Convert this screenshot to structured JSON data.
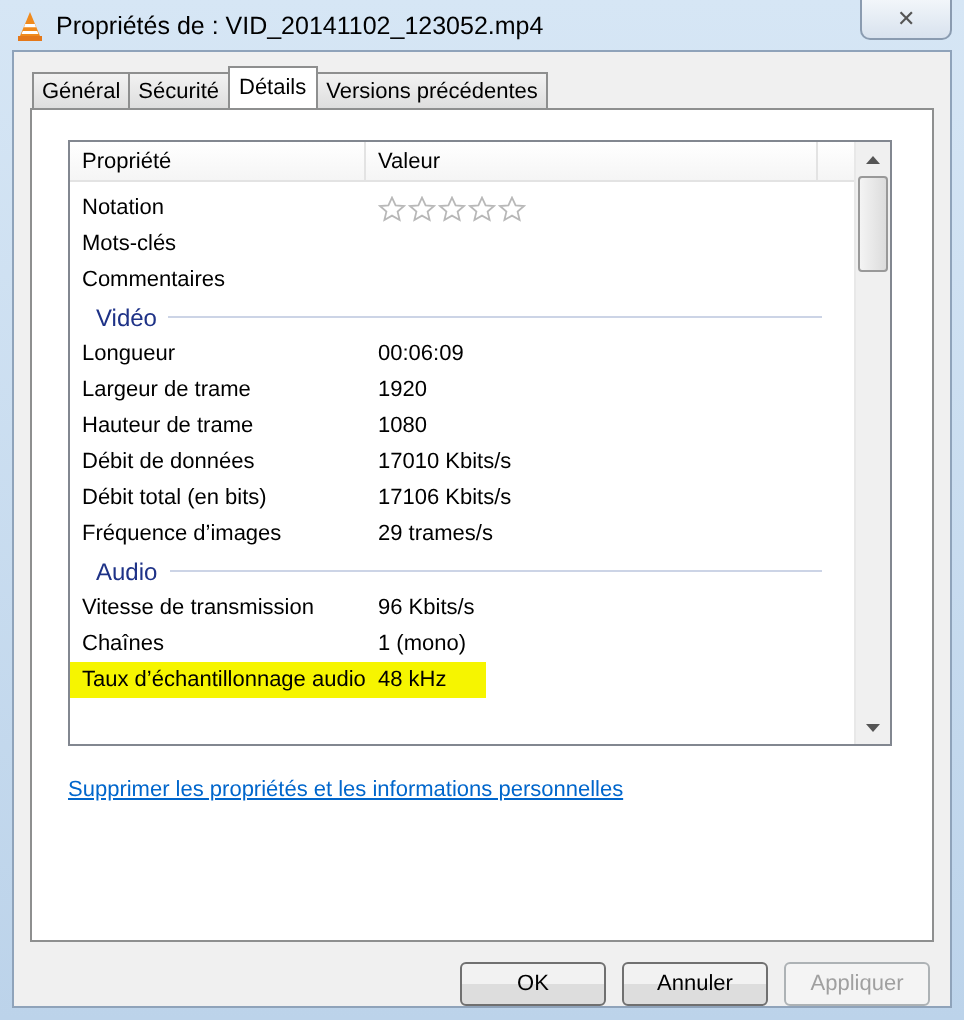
{
  "window": {
    "title": "Propriétés de : VID_20141102_123052.mp4",
    "close": "✕"
  },
  "tabs": [
    {
      "label": "Général",
      "selected": false
    },
    {
      "label": "Sécurité",
      "selected": false
    },
    {
      "label": "Détails",
      "selected": true
    },
    {
      "label": "Versions précédentes",
      "selected": false
    }
  ],
  "table": {
    "columns": [
      "Propriété",
      "Valeur"
    ],
    "rows": [
      {
        "kind": "stars",
        "name": "Notation",
        "stars": 0
      },
      {
        "kind": "property",
        "name": "Mots-clés",
        "value": "",
        "highlighted": false
      },
      {
        "kind": "property",
        "name": "Commentaires",
        "value": "",
        "highlighted": false
      },
      {
        "kind": "group",
        "name": "Vidéo"
      },
      {
        "kind": "property",
        "name": "Longueur",
        "value": "00:06:09",
        "highlighted": false
      },
      {
        "kind": "property",
        "name": "Largeur de trame",
        "value": "1920",
        "highlighted": false
      },
      {
        "kind": "property",
        "name": "Hauteur de trame",
        "value": "1080",
        "highlighted": false
      },
      {
        "kind": "property",
        "name": "Débit de données",
        "value": "17010 Kbits/s",
        "highlighted": false
      },
      {
        "kind": "property",
        "name": "Débit total (en bits)",
        "value": "17106 Kbits/s",
        "highlighted": false
      },
      {
        "kind": "property",
        "name": "Fréquence d’images",
        "value": "29 trames/s",
        "highlighted": false
      },
      {
        "kind": "group",
        "name": "Audio"
      },
      {
        "kind": "property",
        "name": "Vitesse de transmission",
        "value": "96 Kbits/s",
        "highlighted": false
      },
      {
        "kind": "property",
        "name": "Chaînes",
        "value": "1 (mono)",
        "highlighted": false
      },
      {
        "kind": "property",
        "name": "Taux d’échantillonnage audio",
        "value": "48 kHz",
        "highlighted": true
      }
    ]
  },
  "link": "Supprimer les propriétés et les informations personnelles",
  "buttons": [
    {
      "label": "OK",
      "disabled": false
    },
    {
      "label": "Annuler",
      "disabled": false
    },
    {
      "label": "Appliquer",
      "disabled": true
    }
  ]
}
